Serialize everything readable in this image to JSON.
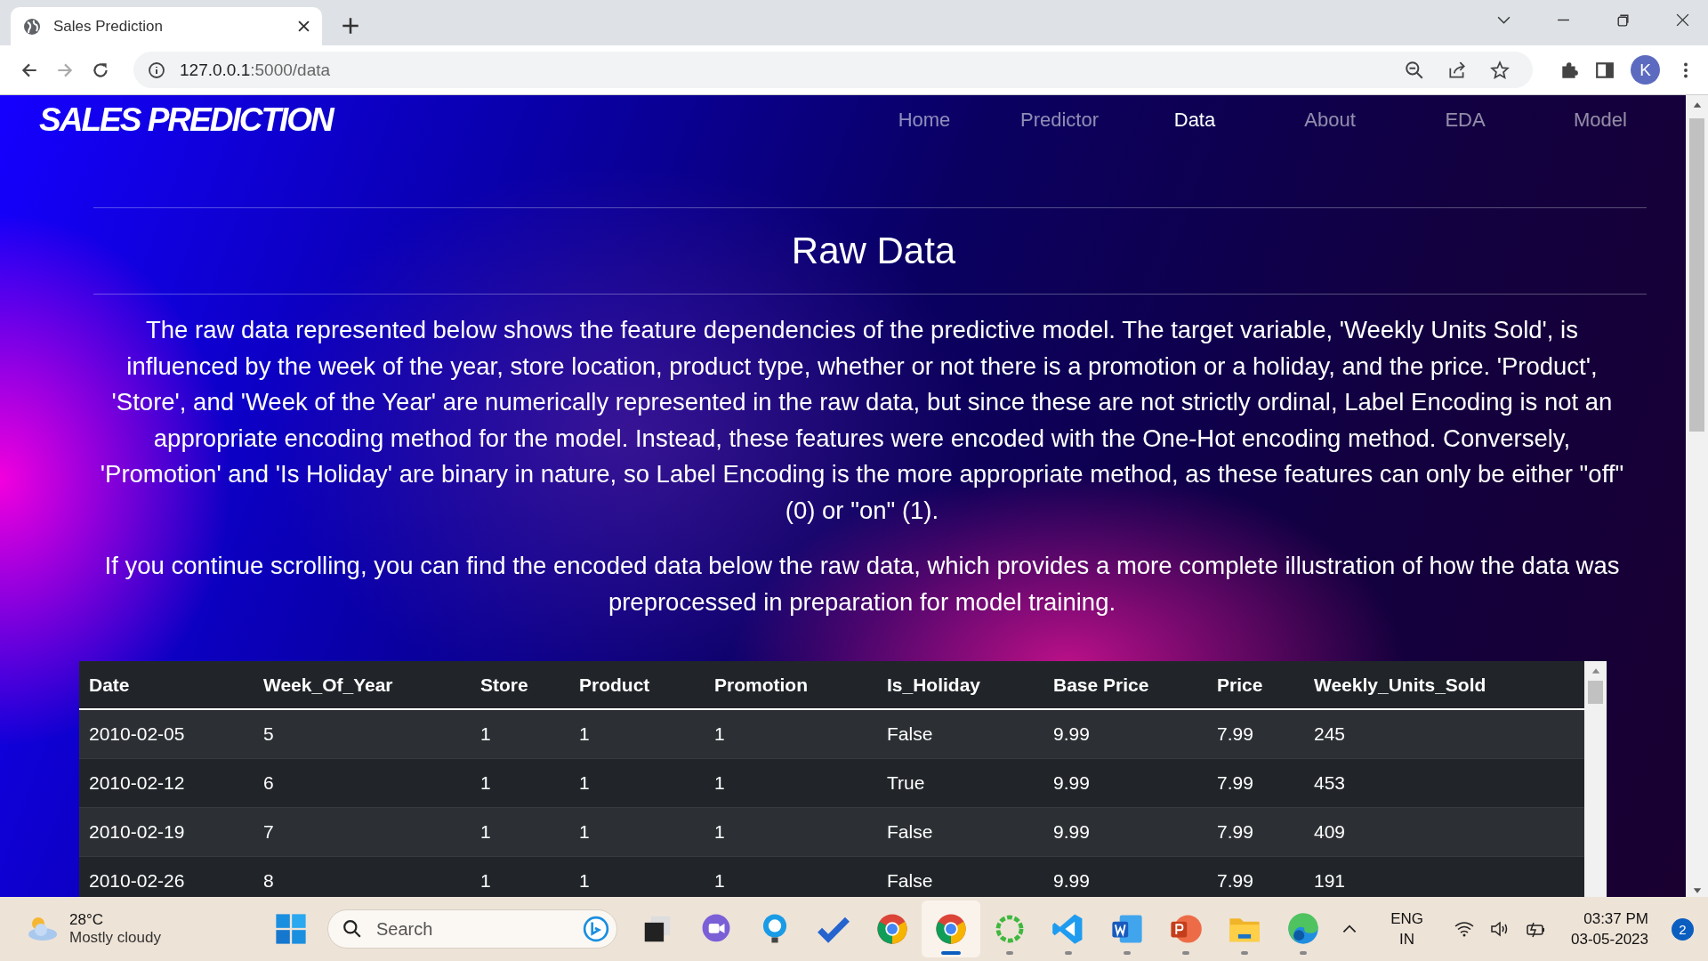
{
  "browser": {
    "tab_title": "Sales Prediction",
    "url_host": "127.0.0.1",
    "url_path": ":5000/data",
    "avatar": "K"
  },
  "site": {
    "brand": "SALES PREDICTION",
    "nav": [
      {
        "label": "Home",
        "selected": false
      },
      {
        "label": "Predictor",
        "selected": false
      },
      {
        "label": "Data",
        "selected": true
      },
      {
        "label": "About",
        "selected": false
      },
      {
        "label": "EDA",
        "selected": false
      },
      {
        "label": "Model",
        "selected": false
      }
    ]
  },
  "heading": "Raw Data",
  "paragraphs": [
    "The raw data represented below shows the feature dependencies of the predictive model. The target variable, 'Weekly Units Sold', is influenced by the week of the year, store location, product type, whether or not there is a promotion or a holiday, and the price. 'Product', 'Store', and 'Week of the Year' are numerically represented in the raw data, but since these are not strictly ordinal, Label Encoding is not an appropriate encoding method for the model. Instead, these features were encoded with the One-Hot encoding method. Conversely, 'Promotion' and 'Is Holiday' are binary in nature, so Label Encoding is the more appropriate method, as these features can only be either \"off\" (0) or \"on\" (1).",
    "If you continue scrolling, you can find the encoded data below the raw data, which provides a more complete illustration of how the data was preprocessed in preparation for model training."
  ],
  "table": {
    "columns": [
      "Date",
      "Week_Of_Year",
      "Store",
      "Product",
      "Promotion",
      "Is_Holiday",
      "Base Price",
      "Price",
      "Weekly_Units_Sold"
    ],
    "rows": [
      [
        "2010-02-05",
        "5",
        "1",
        "1",
        "1",
        "False",
        "9.99",
        "7.99",
        "245"
      ],
      [
        "2010-02-12",
        "6",
        "1",
        "1",
        "1",
        "True",
        "9.99",
        "7.99",
        "453"
      ],
      [
        "2010-02-19",
        "7",
        "1",
        "1",
        "1",
        "False",
        "9.99",
        "7.99",
        "409"
      ],
      [
        "2010-02-26",
        "8",
        "1",
        "1",
        "1",
        "False",
        "9.99",
        "7.99",
        "191"
      ]
    ]
  },
  "taskbar": {
    "temperature": "28°C",
    "weather": "Mostly cloudy",
    "search_placeholder": "Search",
    "apps": [
      {
        "kind": "taskview",
        "running": false,
        "selected": false
      },
      {
        "kind": "meet",
        "running": false,
        "selected": false
      },
      {
        "kind": "bulb",
        "running": false,
        "selected": false
      },
      {
        "kind": "todo",
        "running": false,
        "selected": false
      },
      {
        "kind": "chrome",
        "running": false,
        "selected": false
      },
      {
        "kind": "chrome",
        "running": true,
        "selected": true
      },
      {
        "kind": "ring",
        "running": true,
        "selected": false
      },
      {
        "kind": "vscode",
        "running": true,
        "selected": false
      },
      {
        "kind": "word",
        "running": true,
        "selected": false
      },
      {
        "kind": "powerpoint",
        "running": true,
        "selected": false
      },
      {
        "kind": "folder",
        "running": true,
        "selected": false
      },
      {
        "kind": "edge",
        "running": true,
        "selected": false
      }
    ],
    "language": "ENG",
    "region": "IN",
    "time": "03:37 PM",
    "date": "03-05-2023",
    "notifications": "2"
  }
}
